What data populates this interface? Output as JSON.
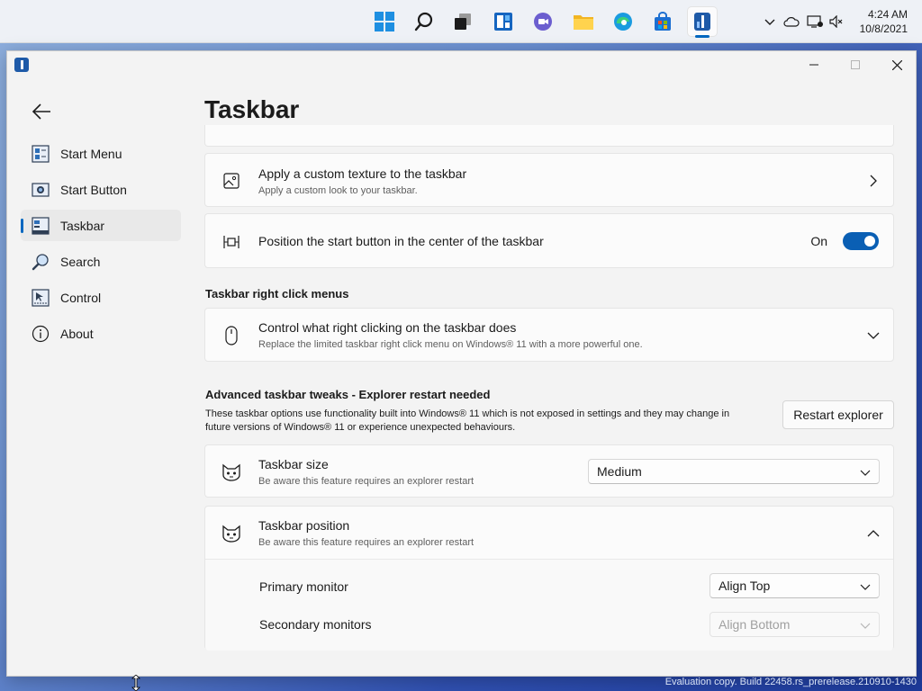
{
  "taskbar": {
    "apps": [
      {
        "name": "start",
        "icon": "windows-logo-icon"
      },
      {
        "name": "search",
        "icon": "search-icon"
      },
      {
        "name": "task-view",
        "icon": "task-view-icon"
      },
      {
        "name": "widgets",
        "icon": "widgets-icon"
      },
      {
        "name": "chat",
        "icon": "teams-chat-icon"
      },
      {
        "name": "file-explorer",
        "icon": "folder-icon"
      },
      {
        "name": "edge",
        "icon": "edge-icon"
      },
      {
        "name": "store",
        "icon": "store-icon"
      },
      {
        "name": "start11",
        "icon": "start11-app-icon",
        "active": true
      }
    ],
    "tray_icons": [
      "chevron-up-icon",
      "onedrive-cloud-icon",
      "network-icon",
      "volume-muted-icon"
    ],
    "time": "4:24 AM",
    "date": "10/8/2021"
  },
  "window": {
    "app_icon": "start11-app-icon",
    "controls": [
      "minimize-icon",
      "maximize-icon",
      "close-icon"
    ]
  },
  "nav": {
    "back_icon": "back-arrow-icon",
    "items": [
      {
        "label": "Start Menu",
        "icon": "start-menu-icon"
      },
      {
        "label": "Start Button",
        "icon": "start-button-icon"
      },
      {
        "label": "Taskbar",
        "icon": "taskbar-icon",
        "selected": true
      },
      {
        "label": "Search",
        "icon": "search-icon"
      },
      {
        "label": "Control",
        "icon": "control-icon"
      },
      {
        "label": "About",
        "icon": "info-icon"
      }
    ]
  },
  "page": {
    "title": "Taskbar",
    "texture_card": {
      "title": "Apply a custom texture to the taskbar",
      "subtitle": "Apply a custom look to your taskbar.",
      "icon": "image-icon"
    },
    "center_card": {
      "title": "Position the start button in the center of the taskbar",
      "toggle_state": "On",
      "toggle_on": true,
      "icon": "center-align-icon"
    },
    "right_click_section": {
      "header": "Taskbar right click menus",
      "card_title": "Control what right clicking on the taskbar does",
      "card_subtitle": "Replace the limited taskbar right click menu on Windows® 11 with a more powerful one.",
      "icon": "mouse-icon"
    },
    "advanced_section": {
      "header": "Advanced taskbar tweaks - Explorer restart needed",
      "description": "These taskbar options use functionality built into Windows® 11 which is not exposed in settings and they may change in future versions of Windows® 11 or experience unexpected behaviours.",
      "restart_button": "Restart explorer"
    },
    "size_card": {
      "title": "Taskbar size",
      "subtitle": "Be aware this feature requires an explorer restart",
      "selected": "Medium",
      "icon": "cat-icon"
    },
    "position_card": {
      "title": "Taskbar position",
      "subtitle": "Be aware this feature requires an explorer restart",
      "icon": "cat-icon",
      "expanded": true,
      "primary_label": "Primary monitor",
      "primary_value": "Align Top",
      "secondary_label": "Secondary monitors",
      "secondary_value": "Align Bottom",
      "secondary_disabled": true
    }
  },
  "watermark": "Evaluation copy. Build 22458.rs_prerelease.210910-1430"
}
